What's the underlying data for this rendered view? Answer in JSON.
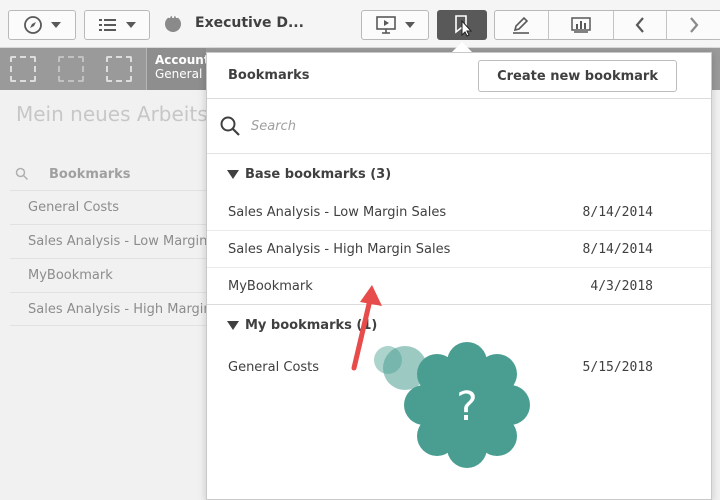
{
  "toolbar": {
    "app_title": "Executive D..."
  },
  "field_tab": {
    "line1": "Account",
    "line2": "General"
  },
  "sheet": {
    "title": "Mein neues Arbeitsblatt",
    "list_header": "Bookmarks",
    "list_items": [
      "General Costs",
      "Sales Analysis - Low Margin Sales",
      "MyBookmark",
      "Sales Analysis - High Margin Sales"
    ]
  },
  "panel": {
    "title": "Bookmarks",
    "create_label": "Create new bookmark",
    "search_placeholder": "Search",
    "base_group": "Base bookmarks (3)",
    "base_items": [
      {
        "name": "Sales Analysis - Low Margin Sales",
        "date": "8/14/2014"
      },
      {
        "name": "Sales Analysis - High Margin Sales",
        "date": "8/14/2014"
      },
      {
        "name": "MyBookmark",
        "date": "4/3/2018"
      }
    ],
    "my_group": "My bookmarks (1)",
    "my_items": [
      {
        "name": "General Costs",
        "date": "5/15/2018"
      }
    ]
  },
  "help_badge": {
    "symbol": "?",
    "color": "#4a9e91"
  },
  "colors": {
    "active_button": "#595959",
    "arrow": "#e84b4b"
  },
  "icons": {
    "compass": "compass-icon",
    "list": "list-icon",
    "present": "presentation-icon",
    "bookmark": "bookmark-icon",
    "edit": "pencil-icon",
    "story": "story-icon",
    "prev": "chevron-left-icon",
    "next": "chevron-right-icon",
    "search": "search-icon"
  }
}
